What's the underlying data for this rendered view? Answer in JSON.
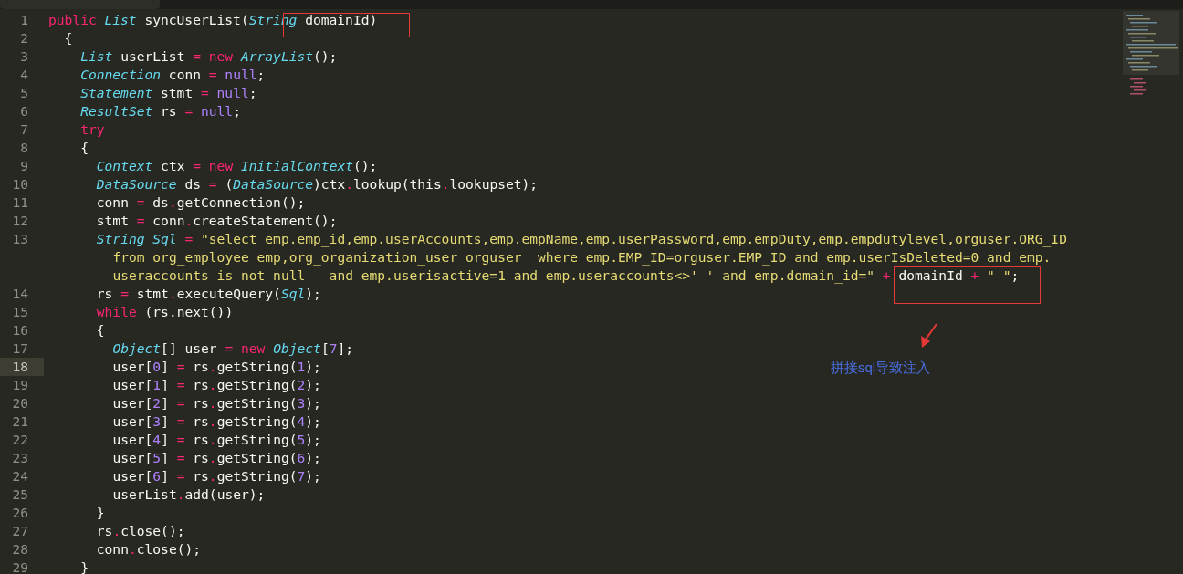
{
  "editor": {
    "lines": [
      {
        "number": "1",
        "current": false,
        "tokens": [
          {
            "kind": "keyword",
            "text": "public"
          },
          {
            "kind": "type",
            "text": " List"
          },
          {
            "kind": "plain",
            "text": " syncUserList("
          },
          {
            "kind": "type",
            "text": "String"
          },
          {
            "kind": "plain",
            "text": " domainId)"
          }
        ],
        "children": [
          {
            "number": "2",
            "current": false,
            "tokens": [
              {
                "kind": "plain",
                "text": "{"
              }
            ],
            "children": [
              {
                "number": "3",
                "current": false,
                "tokens": [
                  {
                    "kind": "type",
                    "text": "List"
                  },
                  {
                    "kind": "plain",
                    "text": " userList "
                  },
                  {
                    "kind": "operator",
                    "text": "="
                  },
                  {
                    "kind": "keyword",
                    "text": " new"
                  },
                  {
                    "kind": "type",
                    "text": " ArrayList"
                  },
                  {
                    "kind": "plain",
                    "text": "();"
                  }
                ]
              },
              {
                "number": "4",
                "current": false,
                "tokens": [
                  {
                    "kind": "type",
                    "text": "Connection"
                  },
                  {
                    "kind": "plain",
                    "text": " conn "
                  },
                  {
                    "kind": "operator",
                    "text": "="
                  },
                  {
                    "kind": "number",
                    "text": " null"
                  },
                  {
                    "kind": "plain",
                    "text": ";"
                  }
                ]
              },
              {
                "number": "5",
                "current": false,
                "tokens": [
                  {
                    "kind": "type",
                    "text": "Statement"
                  },
                  {
                    "kind": "plain",
                    "text": " stmt "
                  },
                  {
                    "kind": "operator",
                    "text": "="
                  },
                  {
                    "kind": "number",
                    "text": " null"
                  },
                  {
                    "kind": "plain",
                    "text": ";"
                  }
                ]
              },
              {
                "number": "6",
                "current": false,
                "tokens": [
                  {
                    "kind": "type",
                    "text": "ResultSet"
                  },
                  {
                    "kind": "plain",
                    "text": " rs "
                  },
                  {
                    "kind": "operator",
                    "text": "="
                  },
                  {
                    "kind": "number",
                    "text": " null"
                  },
                  {
                    "kind": "plain",
                    "text": ";"
                  }
                ]
              },
              {
                "number": "7",
                "current": false,
                "tokens": [
                  {
                    "kind": "keyword",
                    "text": "try"
                  }
                ]
              },
              {
                "number": "8",
                "current": false,
                "tokens": [
                  {
                    "kind": "plain",
                    "text": "{"
                  }
                ],
                "children": [
                  {
                    "number": "9",
                    "current": false,
                    "tokens": [
                      {
                        "kind": "type",
                        "text": "Context"
                      },
                      {
                        "kind": "plain",
                        "text": " ctx "
                      },
                      {
                        "kind": "operator",
                        "text": "="
                      },
                      {
                        "kind": "keyword",
                        "text": " new"
                      },
                      {
                        "kind": "type",
                        "text": " InitialContext"
                      },
                      {
                        "kind": "plain",
                        "text": "();"
                      }
                    ]
                  },
                  {
                    "number": "10",
                    "current": false,
                    "tokens": [
                      {
                        "kind": "type",
                        "text": "DataSource"
                      },
                      {
                        "kind": "plain",
                        "text": " ds "
                      },
                      {
                        "kind": "operator",
                        "text": "="
                      },
                      {
                        "kind": "plain",
                        "text": " ("
                      },
                      {
                        "kind": "type",
                        "text": "DataSource"
                      },
                      {
                        "kind": "plain",
                        "text": ")ctx"
                      },
                      {
                        "kind": "operator",
                        "text": "."
                      },
                      {
                        "kind": "plain",
                        "text": "lookup(this"
                      },
                      {
                        "kind": "operator",
                        "text": "."
                      },
                      {
                        "kind": "plain",
                        "text": "lookupset);"
                      }
                    ]
                  },
                  {
                    "number": "11",
                    "current": false,
                    "tokens": [
                      {
                        "kind": "plain",
                        "text": "conn "
                      },
                      {
                        "kind": "operator",
                        "text": "="
                      },
                      {
                        "kind": "plain",
                        "text": " ds"
                      },
                      {
                        "kind": "operator",
                        "text": "."
                      },
                      {
                        "kind": "plain",
                        "text": "getConnection();"
                      }
                    ]
                  },
                  {
                    "number": "12",
                    "current": false,
                    "tokens": [
                      {
                        "kind": "plain",
                        "text": "stmt "
                      },
                      {
                        "kind": "operator",
                        "text": "="
                      },
                      {
                        "kind": "plain",
                        "text": " conn"
                      },
                      {
                        "kind": "operator",
                        "text": "."
                      },
                      {
                        "kind": "plain",
                        "text": "createStatement();"
                      }
                    ]
                  },
                  {
                    "number": "13",
                    "current": false,
                    "tokens": [
                      {
                        "kind": "type",
                        "text": "String"
                      },
                      {
                        "kind": "type",
                        "text": " Sql"
                      },
                      {
                        "kind": "operator",
                        "text": " ="
                      },
                      {
                        "kind": "string",
                        "text": " \"select emp.emp_id,emp.userAccounts,emp.empName,emp.userPassword,emp.empDuty,emp.empdutylevel,orguser.ORG_ID"
                      }
                    ],
                    "continuation": [
                      [
                        {
                          "kind": "string",
                          "text": "from org_employee emp,org_organization_user orguser  where emp.EMP_ID=orguser.EMP_ID and emp.userIsDeleted=0 and emp."
                        }
                      ],
                      [
                        {
                          "kind": "string",
                          "text": "useraccounts is not null   and emp.userisactive=1 and emp.useraccounts<>' ' and emp.domain_id=\""
                        },
                        {
                          "kind": "operator",
                          "text": " +"
                        },
                        {
                          "kind": "plain",
                          "text": " domainId "
                        },
                        {
                          "kind": "operator",
                          "text": "+"
                        },
                        {
                          "kind": "string",
                          "text": " \" \""
                        },
                        {
                          "kind": "plain",
                          "text": ";"
                        }
                      ]
                    ]
                  },
                  {
                    "number": "14",
                    "current": false,
                    "tokens": [
                      {
                        "kind": "plain",
                        "text": "rs "
                      },
                      {
                        "kind": "operator",
                        "text": "="
                      },
                      {
                        "kind": "plain",
                        "text": " stmt"
                      },
                      {
                        "kind": "operator",
                        "text": "."
                      },
                      {
                        "kind": "plain",
                        "text": "executeQuery("
                      },
                      {
                        "kind": "type",
                        "text": "Sql"
                      },
                      {
                        "kind": "plain",
                        "text": ");"
                      }
                    ]
                  },
                  {
                    "number": "15",
                    "current": false,
                    "tokens": [
                      {
                        "kind": "keyword",
                        "text": "while"
                      },
                      {
                        "kind": "plain",
                        "text": " (rs.next())"
                      }
                    ]
                  },
                  {
                    "number": "16",
                    "current": false,
                    "tokens": [
                      {
                        "kind": "plain",
                        "text": "{"
                      }
                    ],
                    "children": [
                      {
                        "number": "17",
                        "current": false,
                        "tokens": [
                          {
                            "kind": "type",
                            "text": "Object"
                          },
                          {
                            "kind": "plain",
                            "text": "[] user "
                          },
                          {
                            "kind": "operator",
                            "text": "="
                          },
                          {
                            "kind": "keyword",
                            "text": " new"
                          },
                          {
                            "kind": "type",
                            "text": " Object"
                          },
                          {
                            "kind": "plain",
                            "text": "["
                          },
                          {
                            "kind": "number",
                            "text": "7"
                          },
                          {
                            "kind": "plain",
                            "text": "];"
                          }
                        ]
                      },
                      {
                        "number": "18",
                        "current": true,
                        "tokens": [
                          {
                            "kind": "plain",
                            "text": "user["
                          },
                          {
                            "kind": "number",
                            "text": "0"
                          },
                          {
                            "kind": "plain",
                            "text": "] "
                          },
                          {
                            "kind": "operator",
                            "text": "="
                          },
                          {
                            "kind": "plain",
                            "text": " rs"
                          },
                          {
                            "kind": "operator",
                            "text": "."
                          },
                          {
                            "kind": "plain",
                            "text": "getString("
                          },
                          {
                            "kind": "number",
                            "text": "1"
                          },
                          {
                            "kind": "plain",
                            "text": ");"
                          }
                        ]
                      },
                      {
                        "number": "19",
                        "current": false,
                        "tokens": [
                          {
                            "kind": "plain",
                            "text": "user["
                          },
                          {
                            "kind": "number",
                            "text": "1"
                          },
                          {
                            "kind": "plain",
                            "text": "] "
                          },
                          {
                            "kind": "operator",
                            "text": "="
                          },
                          {
                            "kind": "plain",
                            "text": " rs"
                          },
                          {
                            "kind": "operator",
                            "text": "."
                          },
                          {
                            "kind": "plain",
                            "text": "getString("
                          },
                          {
                            "kind": "number",
                            "text": "2"
                          },
                          {
                            "kind": "plain",
                            "text": ");"
                          }
                        ]
                      },
                      {
                        "number": "20",
                        "current": false,
                        "tokens": [
                          {
                            "kind": "plain",
                            "text": "user["
                          },
                          {
                            "kind": "number",
                            "text": "2"
                          },
                          {
                            "kind": "plain",
                            "text": "] "
                          },
                          {
                            "kind": "operator",
                            "text": "="
                          },
                          {
                            "kind": "plain",
                            "text": " rs"
                          },
                          {
                            "kind": "operator",
                            "text": "."
                          },
                          {
                            "kind": "plain",
                            "text": "getString("
                          },
                          {
                            "kind": "number",
                            "text": "3"
                          },
                          {
                            "kind": "plain",
                            "text": ");"
                          }
                        ]
                      },
                      {
                        "number": "21",
                        "current": false,
                        "tokens": [
                          {
                            "kind": "plain",
                            "text": "user["
                          },
                          {
                            "kind": "number",
                            "text": "3"
                          },
                          {
                            "kind": "plain",
                            "text": "] "
                          },
                          {
                            "kind": "operator",
                            "text": "="
                          },
                          {
                            "kind": "plain",
                            "text": " rs"
                          },
                          {
                            "kind": "operator",
                            "text": "."
                          },
                          {
                            "kind": "plain",
                            "text": "getString("
                          },
                          {
                            "kind": "number",
                            "text": "4"
                          },
                          {
                            "kind": "plain",
                            "text": ");"
                          }
                        ]
                      },
                      {
                        "number": "22",
                        "current": false,
                        "tokens": [
                          {
                            "kind": "plain",
                            "text": "user["
                          },
                          {
                            "kind": "number",
                            "text": "4"
                          },
                          {
                            "kind": "plain",
                            "text": "] "
                          },
                          {
                            "kind": "operator",
                            "text": "="
                          },
                          {
                            "kind": "plain",
                            "text": " rs"
                          },
                          {
                            "kind": "operator",
                            "text": "."
                          },
                          {
                            "kind": "plain",
                            "text": "getString("
                          },
                          {
                            "kind": "number",
                            "text": "5"
                          },
                          {
                            "kind": "plain",
                            "text": ");"
                          }
                        ]
                      },
                      {
                        "number": "23",
                        "current": false,
                        "tokens": [
                          {
                            "kind": "plain",
                            "text": "user["
                          },
                          {
                            "kind": "number",
                            "text": "5"
                          },
                          {
                            "kind": "plain",
                            "text": "] "
                          },
                          {
                            "kind": "operator",
                            "text": "="
                          },
                          {
                            "kind": "plain",
                            "text": " rs"
                          },
                          {
                            "kind": "operator",
                            "text": "."
                          },
                          {
                            "kind": "plain",
                            "text": "getString("
                          },
                          {
                            "kind": "number",
                            "text": "6"
                          },
                          {
                            "kind": "plain",
                            "text": ");"
                          }
                        ]
                      },
                      {
                        "number": "24",
                        "current": false,
                        "tokens": [
                          {
                            "kind": "plain",
                            "text": "user["
                          },
                          {
                            "kind": "number",
                            "text": "6"
                          },
                          {
                            "kind": "plain",
                            "text": "] "
                          },
                          {
                            "kind": "operator",
                            "text": "="
                          },
                          {
                            "kind": "plain",
                            "text": " rs"
                          },
                          {
                            "kind": "operator",
                            "text": "."
                          },
                          {
                            "kind": "plain",
                            "text": "getString("
                          },
                          {
                            "kind": "number",
                            "text": "7"
                          },
                          {
                            "kind": "plain",
                            "text": ");"
                          }
                        ]
                      },
                      {
                        "number": "25",
                        "current": false,
                        "tokens": [
                          {
                            "kind": "plain",
                            "text": "userList"
                          },
                          {
                            "kind": "operator",
                            "text": "."
                          },
                          {
                            "kind": "plain",
                            "text": "add(user);"
                          }
                        ]
                      }
                    ]
                  },
                  {
                    "number": "26",
                    "current": false,
                    "tokens": [
                      {
                        "kind": "plain",
                        "text": "}"
                      }
                    ]
                  },
                  {
                    "number": "27",
                    "current": false,
                    "tokens": [
                      {
                        "kind": "plain",
                        "text": "rs"
                      },
                      {
                        "kind": "operator",
                        "text": "."
                      },
                      {
                        "kind": "plain",
                        "text": "close();"
                      }
                    ]
                  },
                  {
                    "number": "28",
                    "current": false,
                    "tokens": [
                      {
                        "kind": "plain",
                        "text": "conn"
                      },
                      {
                        "kind": "operator",
                        "text": "."
                      },
                      {
                        "kind": "plain",
                        "text": "close();"
                      }
                    ]
                  }
                ]
              },
              {
                "number": "29",
                "current": false,
                "tokens": [
                  {
                    "kind": "plain",
                    "text": "}"
                  }
                ]
              }
            ]
          }
        ]
      }
    ]
  },
  "annotation": {
    "text": "拼接sql导致注入"
  }
}
